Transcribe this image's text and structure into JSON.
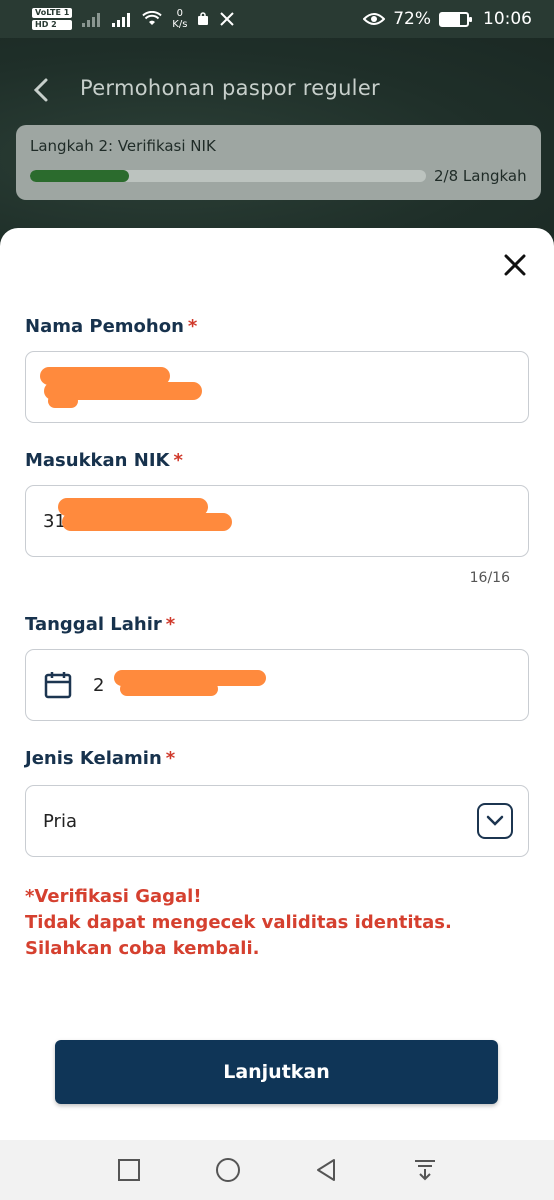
{
  "status_bar": {
    "badge_top": "VoLTE 1",
    "badge_bottom": "HD 2",
    "speed_value": "0",
    "speed_unit": "K/s",
    "battery": "72%",
    "time": "10:06",
    "battery_level": 0.72
  },
  "header": {
    "title": "Permohonan paspor reguler"
  },
  "step": {
    "label": "Langkah 2: Verifikasi NIK",
    "count": "2/8 Langkah",
    "progress": 0.25
  },
  "form": {
    "name": {
      "label": "Nama Pemohon",
      "required": "*"
    },
    "nik": {
      "label": "Masukkan NIK",
      "required": "*",
      "value_prefix": "31",
      "counter": "16/16"
    },
    "dob": {
      "label": "Tanggal Lahir",
      "required": "*",
      "value_prefix": "2"
    },
    "gender": {
      "label": "Jenis Kelamin",
      "required": "*",
      "value": "Pria"
    },
    "error": "*Verifikasi Gagal!\n Tidak dapat mengecek validitas identitas. Silahkan coba kembali.",
    "submit_label": "Lanjutkan"
  },
  "colors": {
    "primary": "#0f3557",
    "error": "#d5402f",
    "progress": "#2b6b2d",
    "redaction": "#ff8a3d"
  }
}
